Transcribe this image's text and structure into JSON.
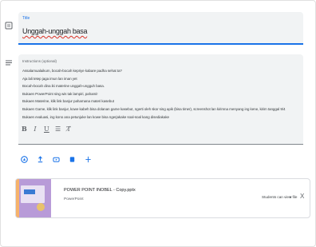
{
  "title": {
    "label": "Title",
    "value": "Unggah-unggah basa"
  },
  "instructions": {
    "label": "Instructions (optional)",
    "lines": [
      "Assalamualaikum, bocah-bocah kepriye kabare padha sehat ta?",
      "Aja lali tetep jaga imun lan iman yet",
      "Bocah-bocah dina iki materine unggah-ungguh basa.",
      "Bukaen PowerPoint sing wis tak lampiri, pahami!",
      "Bukaen Materine, klik link banjur pahamana materi kasebut",
      "Bukaen Game, klik link banjur, kowe kabeh bisa dolanan game kasebut, ngerti oleh skor sing apik (bisa timer), screenshot lan kirimna menyang ing kene, kirim tanggal 9/4",
      "Bukaen evaluasi, ing kono ana petunjuke lan kowe bisa ngerjakake soal-soal kang disediakake"
    ]
  },
  "formatting": {
    "bold": "B",
    "italic": "I",
    "underline": "U",
    "list": "☰",
    "clear": "T̸"
  },
  "attachments_bar": {
    "drive_icon": "drive-icon",
    "upload_icon": "upload-icon",
    "youtube_icon": "youtube-icon",
    "create_icon": "create-icon",
    "link_icon": "link-icon"
  },
  "file": {
    "name": "POWER POINT INOBEL - Copy.pptx",
    "type": "PowerPoint",
    "permission": "Students can view file",
    "permission_arrow": "▼",
    "remove": "X"
  },
  "colors": {
    "accent": "#1a73e8",
    "field_bg": "#f1f3f4",
    "thumb": "#b89bd8"
  }
}
